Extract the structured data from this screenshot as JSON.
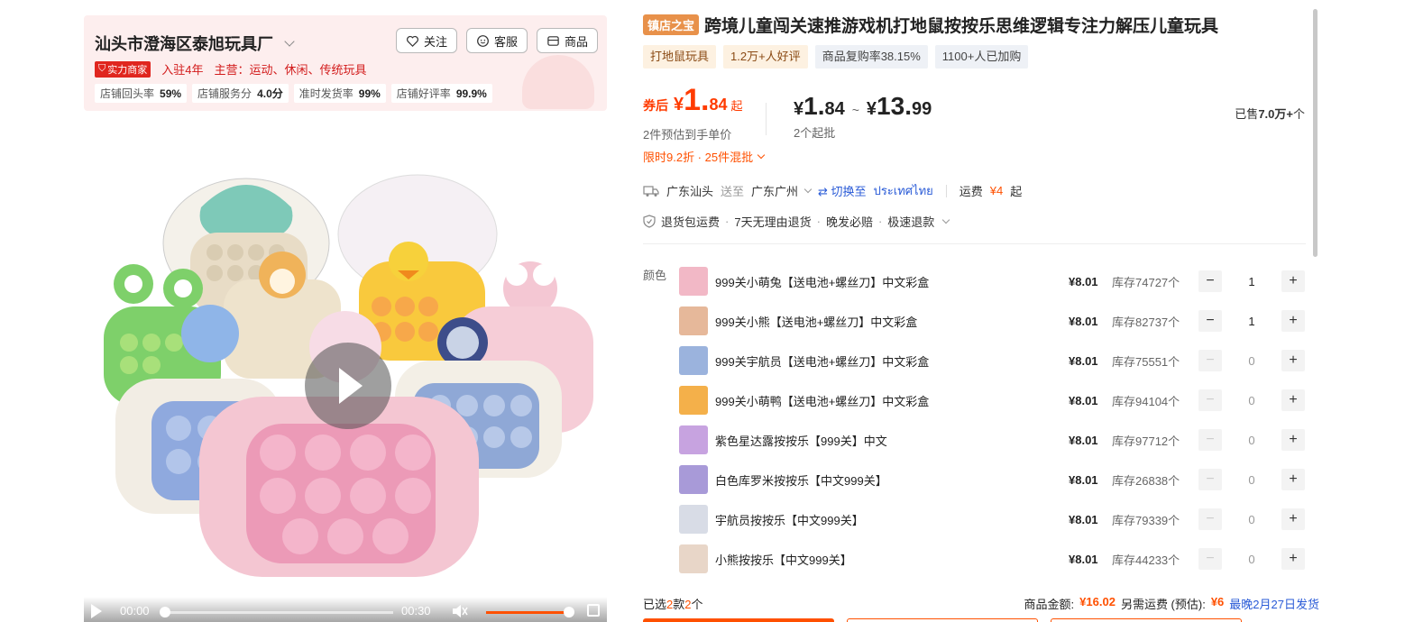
{
  "shop": {
    "name": "汕头市澄海区泰旭玩具厂",
    "follow_label": "关注",
    "service_label": "客服",
    "goods_label": "商品",
    "strength_badge": "实力商家",
    "years": "入驻4年",
    "main_business": "主营：运动、休闲、传统玩具",
    "stats": [
      {
        "label": "店铺回头率",
        "value": "59%"
      },
      {
        "label": "店铺服务分",
        "value": "4.0分"
      },
      {
        "label": "准时发货率",
        "value": "99%"
      },
      {
        "label": "店铺好评率",
        "value": "99.9%"
      }
    ]
  },
  "video": {
    "current_time": "00:00",
    "duration": "00:30",
    "progress": 0,
    "volume": 0.9
  },
  "product": {
    "badge": "镇店之宝",
    "title": "跨境儿童闯关速推游戏机打地鼠按按乐思维逻辑专注力解压儿童玩具",
    "tags": [
      "打地鼠玩具",
      "1.2万+人好评",
      "商品复购率38.15%",
      "1100+人已加购"
    ]
  },
  "price": {
    "coupon_label": "券后",
    "yen": "¥",
    "coupon_int": "1.",
    "coupon_dec": "84",
    "qi": "起",
    "coupon_note": "2件预估到手单价",
    "promo": "限时9.2折 · 25件混批",
    "range_low_int": "1.",
    "range_low_dec": "84",
    "tilde": "~",
    "range_high_int": "13.",
    "range_high_dec": "99",
    "moq": "2个起批",
    "sold_prefix": "已售",
    "sold_value": "7.0万+",
    "sold_suffix": "个"
  },
  "shipping": {
    "from": "广东汕头",
    "to_label": "送至",
    "to": "广东广州",
    "switch_label": "⇄ 切换至",
    "switch_target": "ประเทศไทย",
    "fee_label": "运费",
    "fee_value": "¥4",
    "fee_suffix": "起"
  },
  "services": [
    "退货包运费",
    "7天无理由退货",
    "晚发必赔",
    "极速退款"
  ],
  "sku_label": "颜色",
  "skus": [
    {
      "name": "999关小萌兔【送电池+螺丝刀】中文彩盒",
      "price": "¥8.01",
      "stock": "库存74727个",
      "qty": "1",
      "color": "#f2b8c6"
    },
    {
      "name": "999关小熊【送电池+螺丝刀】中文彩盒",
      "price": "¥8.01",
      "stock": "库存82737个",
      "qty": "1",
      "color": "#e6b89a"
    },
    {
      "name": "999关宇航员【送电池+螺丝刀】中文彩盒",
      "price": "¥8.01",
      "stock": "库存75551个",
      "qty": "0",
      "color": "#9bb3dd"
    },
    {
      "name": "999关小萌鸭【送电池+螺丝刀】中文彩盒",
      "price": "¥8.01",
      "stock": "库存94104个",
      "qty": "0",
      "color": "#f4b04a"
    },
    {
      "name": "紫色星达露按按乐【999关】中文",
      "price": "¥8.01",
      "stock": "库存97712个",
      "qty": "0",
      "color": "#c7a3e0"
    },
    {
      "name": "白色库罗米按按乐【中文999关】",
      "price": "¥8.01",
      "stock": "库存26838个",
      "qty": "0",
      "color": "#a89ad8"
    },
    {
      "name": "宇航员按按乐【中文999关】",
      "price": "¥8.01",
      "stock": "库存79339个",
      "qty": "0",
      "color": "#d8dce6"
    },
    {
      "name": "小熊按按乐【中文999关】",
      "price": "¥8.01",
      "stock": "库存44233个",
      "qty": "0",
      "color": "#e8d6c8"
    }
  ],
  "footer": {
    "selected_prefix": "已选",
    "selected_kinds": "2",
    "selected_mid": "款",
    "selected_count": "2",
    "selected_suffix": "个",
    "amount_label": "商品金额:",
    "amount_value": "¥16.02",
    "extra_label": "另需运费 (预估):",
    "extra_value": "¥6",
    "ship_date": "最晚2月27日发货"
  },
  "colors": {
    "accent": "#ff5000",
    "brand_red": "#e0261f",
    "link_blue": "#2a5bd7"
  }
}
